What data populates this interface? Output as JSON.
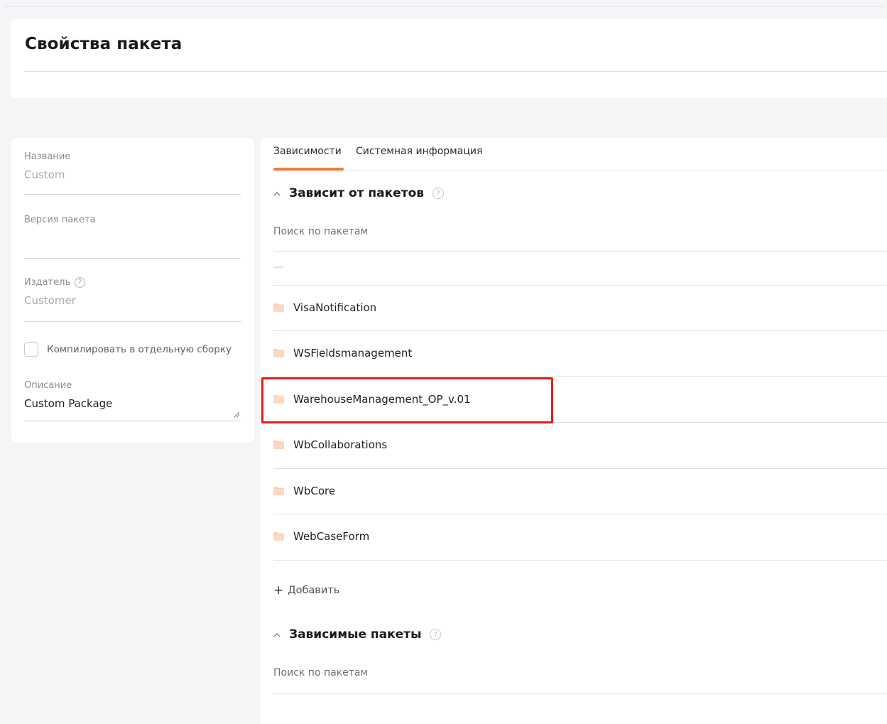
{
  "header": {
    "title": "Свойства пакета"
  },
  "left_panel": {
    "name": {
      "label": "Название",
      "value": "Custom"
    },
    "version": {
      "label": "Версия пакета",
      "value": ""
    },
    "publisher": {
      "label": "Издатель",
      "value": "Customer",
      "help_icon": "question-circle-icon"
    },
    "compile_checkbox": {
      "label": "Компилировать в отдельную сборку",
      "checked": false
    },
    "description": {
      "label": "Описание",
      "value": "Custom Package"
    }
  },
  "tabs": [
    {
      "label": "Зависимости",
      "active": true
    },
    {
      "label": "Системная информация",
      "active": false
    }
  ],
  "depends_on": {
    "title": "Зависит от пакетов",
    "chevron": "^",
    "help_icon": "question-circle-icon",
    "search_placeholder": "Поиск по пакетам",
    "items": [
      {
        "label": "VisaNotification",
        "icon": "folder-icon"
      },
      {
        "label": "WSFieldsmanagement",
        "icon": "folder-icon"
      },
      {
        "label": "WarehouseManagement_OP_v.01",
        "icon": "folder-icon",
        "highlighted": true
      },
      {
        "label": "WbCollaborations",
        "icon": "folder-icon"
      },
      {
        "label": "WbCore",
        "icon": "folder-icon"
      },
      {
        "label": "WebCaseForm",
        "icon": "folder-icon"
      }
    ],
    "add_label": "Добавить",
    "add_icon": "+"
  },
  "dependent": {
    "title": "Зависимые пакеты",
    "chevron": "^",
    "help_icon": "question-circle-icon",
    "search_placeholder": "Поиск по пакетам"
  },
  "colors": {
    "accent": "#f27a3a",
    "folder": "#fbcfb6",
    "highlight": "#e51c1c",
    "background": "#f4f5f7"
  }
}
